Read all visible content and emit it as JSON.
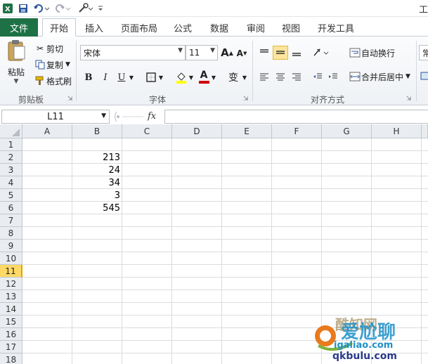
{
  "window": {
    "title_fragment": "工"
  },
  "tabs": [
    {
      "label": "文件"
    },
    {
      "label": "开始"
    },
    {
      "label": "插入"
    },
    {
      "label": "页面布局"
    },
    {
      "label": "公式"
    },
    {
      "label": "数据"
    },
    {
      "label": "审阅"
    },
    {
      "label": "视图"
    },
    {
      "label": "开发工具"
    }
  ],
  "clipboard": {
    "paste_label": "粘贴",
    "cut_label": "剪切",
    "copy_label": "复制",
    "format_painter_label": "格式刷",
    "group_label": "剪贴板"
  },
  "font": {
    "font_name": "宋体",
    "font_size": "11",
    "bold": "B",
    "italic": "I",
    "underline": "U",
    "grow": "A",
    "shrink": "A",
    "font_color_letter": "A",
    "phonetic": "变",
    "group_label": "字体"
  },
  "alignment": {
    "wrap_text_label": "自动换行",
    "merge_center_label": "合并后居中",
    "group_label": "对齐方式"
  },
  "number": {
    "format_fragment": "常"
  },
  "formula_bar": {
    "name_box": "L11",
    "fx_label": "fx",
    "formula_value": ""
  },
  "sheet": {
    "columns": [
      "A",
      "B",
      "C",
      "D",
      "E",
      "F",
      "G",
      "H"
    ],
    "rows": [
      "1",
      "2",
      "3",
      "4",
      "5",
      "6",
      "7",
      "8",
      "9",
      "10",
      "11",
      "12",
      "13",
      "14",
      "15",
      "16",
      "17",
      "18"
    ],
    "selected_row": "11",
    "cells": {
      "B2": "213",
      "B3": "24",
      "B4": "34",
      "B5": "3",
      "B6": "545"
    }
  },
  "watermark": {
    "line1": "爱尬聊",
    "line2": "igaliao.com",
    "line3": "qkbulu.com",
    "brand_fragment": "酷知网"
  },
  "colors": {
    "file_tab": "#1e7145",
    "selected_row": "#ffd966",
    "active_align": "#fde59a",
    "font_color_bar": "#d00000",
    "fill_color_bar": "#ffff00"
  }
}
